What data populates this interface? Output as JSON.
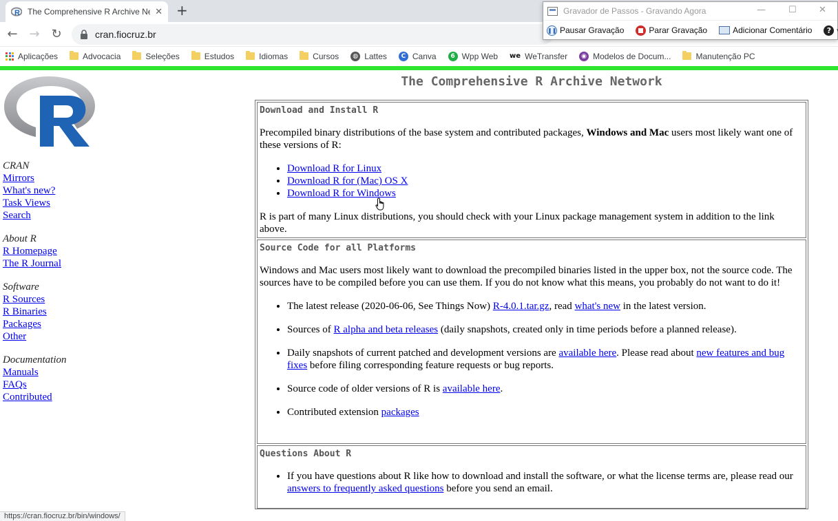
{
  "browser": {
    "tab_title": "The Comprehensive R Archive Ne",
    "url": "cran.fiocruz.br",
    "bookmarks": [
      {
        "label": "Aplicações",
        "icon": "apps-icon"
      },
      {
        "label": "Advocacia",
        "icon": "folder-icon"
      },
      {
        "label": "Seleções",
        "icon": "folder-icon"
      },
      {
        "label": "Estudos",
        "icon": "folder-icon"
      },
      {
        "label": "Idiomas",
        "icon": "folder-icon"
      },
      {
        "label": "Cursos",
        "icon": "folder-icon"
      },
      {
        "label": "Lattes",
        "icon": "globe-icon"
      },
      {
        "label": "Canva",
        "icon": "canva-icon"
      },
      {
        "label": "Wpp Web",
        "icon": "whatsapp-icon"
      },
      {
        "label": "WeTransfer",
        "icon": "wetransfer-icon"
      },
      {
        "label": "Modelos de Docum...",
        "icon": "docs-icon"
      },
      {
        "label": "Manutenção PC",
        "icon": "folder-icon"
      }
    ],
    "status_url": "https://cran.fiocruz.br/bin/windows/"
  },
  "recorder": {
    "title": "Gravador de Passos - Gravando Agora",
    "pause": "Pausar Gravação",
    "stop": "Parar Gravação",
    "comment": "Adicionar Comentário"
  },
  "page": {
    "title": "The Comprehensive R Archive Network",
    "sidebar": {
      "cran_head": "CRAN",
      "cran_links": [
        "Mirrors",
        "What's new?",
        "Task Views",
        "Search"
      ],
      "about_head": "About R",
      "about_links": [
        "R Homepage",
        "The R Journal"
      ],
      "software_head": "Software",
      "software_links": [
        "R Sources",
        "R Binaries",
        "Packages",
        "Other"
      ],
      "doc_head": "Documentation",
      "doc_links": [
        "Manuals",
        "FAQs",
        "Contributed"
      ]
    },
    "download": {
      "head": "Download and Install R",
      "intro_1": "Precompiled binary distributions of the base system and contributed packages, ",
      "intro_bold": "Windows and Mac",
      "intro_2": " users most likely want one of these versions of R:",
      "links": [
        "Download R for Linux",
        "Download R for (Mac) OS X",
        "Download R for Windows"
      ],
      "outro": "R is part of many Linux distributions, you should check with your Linux package management system in addition to the link above."
    },
    "source": {
      "head": "Source Code for all Platforms",
      "intro": "Windows and Mac users most likely want to download the precompiled binaries listed in the upper box, not the source code. The sources have to be compiled before you can use them. If you do not know what this means, you probably do not want to do it!",
      "item1_a": "The latest release (2020-06-06, See Things Now) ",
      "item1_link1": "R-4.0.1.tar.gz",
      "item1_b": ", read ",
      "item1_link2": "what's new",
      "item1_c": " in the latest version.",
      "item2_a": "Sources of ",
      "item2_link": "R alpha and beta releases",
      "item2_b": " (daily snapshots, created only in time periods before a planned release).",
      "item3_a": "Daily snapshots of current patched and development versions are ",
      "item3_link1": "available here",
      "item3_b": ". Please read about ",
      "item3_link2": "new features and bug fixes",
      "item3_c": " before filing corresponding feature requests or bug reports.",
      "item4_a": "Source code of older versions of R is ",
      "item4_link": "available here",
      "item4_b": ".",
      "item5_a": "Contributed extension ",
      "item5_link": "packages"
    },
    "questions": {
      "head": "Questions About R",
      "item_a": "If you have questions about R like how to download and install the software, or what the license terms are, please read our ",
      "item_link": "answers to frequently asked questions",
      "item_b": " before you send an email."
    }
  }
}
